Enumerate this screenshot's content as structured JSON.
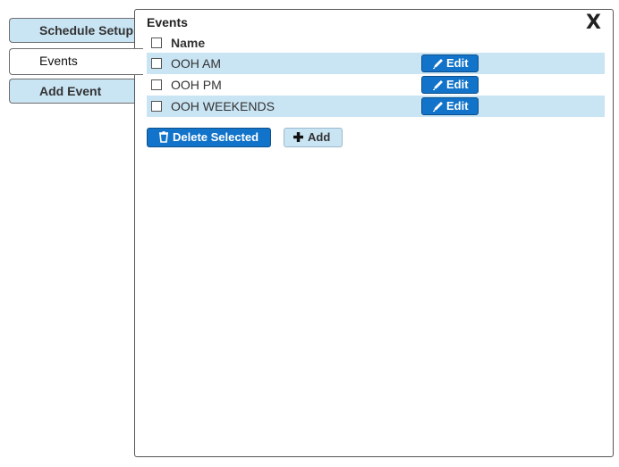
{
  "sidebar": {
    "items": [
      {
        "label": "Schedule Setup",
        "active": false
      },
      {
        "label": "Events",
        "active": true
      },
      {
        "label": "Add Event",
        "active": false
      }
    ]
  },
  "panel": {
    "title": "Events",
    "close_label": "X"
  },
  "table": {
    "header": {
      "name": "Name"
    },
    "rows": [
      {
        "name": "OOH AM",
        "edit_label": "Edit"
      },
      {
        "name": "OOH PM",
        "edit_label": "Edit"
      },
      {
        "name": "OOH WEEKENDS",
        "edit_label": "Edit"
      }
    ]
  },
  "actions": {
    "delete_label": "Delete Selected",
    "add_label": "Add"
  },
  "colors": {
    "accent": "#1173c9",
    "row_band": "#c9e4f3",
    "tab_inactive": "#c9e4f3"
  },
  "icons": {
    "edit": "pencil-icon",
    "delete": "trash-icon",
    "add": "plus-icon"
  }
}
